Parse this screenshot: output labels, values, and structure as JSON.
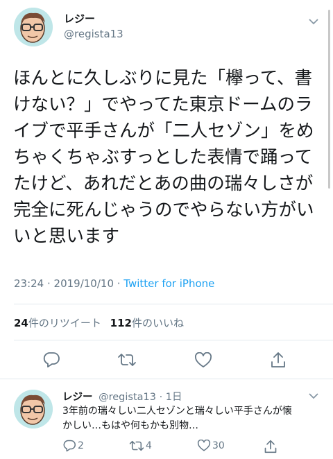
{
  "tweet": {
    "author_name": "レジー",
    "author_handle": "@regista13",
    "text_lines": [
      "ほんとに久しぶりに見た「欅って、書",
      "けない？」でやってた東京ドームのラ",
      "イブで平手さんが「二人セゾン」をめ",
      "ちゃくちゃぶすっとした表情で踊って",
      "たけど、あれだとあの曲の瑞々しさが",
      "完全に死んじゃうのでやらない方がい",
      "いと思います"
    ],
    "meta_time": "23:24 · 2019/10/10 · ",
    "meta_source": "Twitter for iPhone",
    "retweet_count": "24",
    "retweet_label": "件のリツイート",
    "like_count": "112",
    "like_label": "件のいいね"
  },
  "reply": {
    "author_name": "レジー",
    "author_handle_time": "@regista13 · 1日",
    "text_line1": "3年前の瑞々しい二人セゾンと瑞々しい平手さんが懐",
    "text_line2": "かしい…もはや何もかも別物…",
    "reply_count": "2",
    "retweet_count": "4",
    "like_count": "30"
  },
  "colors": {
    "accent": "#1da1f2",
    "muted": "#657786",
    "divider": "#e1e8ed",
    "avatar_bg": "#bfe6e8"
  },
  "icons": [
    "chevron-down-icon",
    "reply-icon",
    "retweet-icon",
    "like-icon",
    "share-icon"
  ]
}
